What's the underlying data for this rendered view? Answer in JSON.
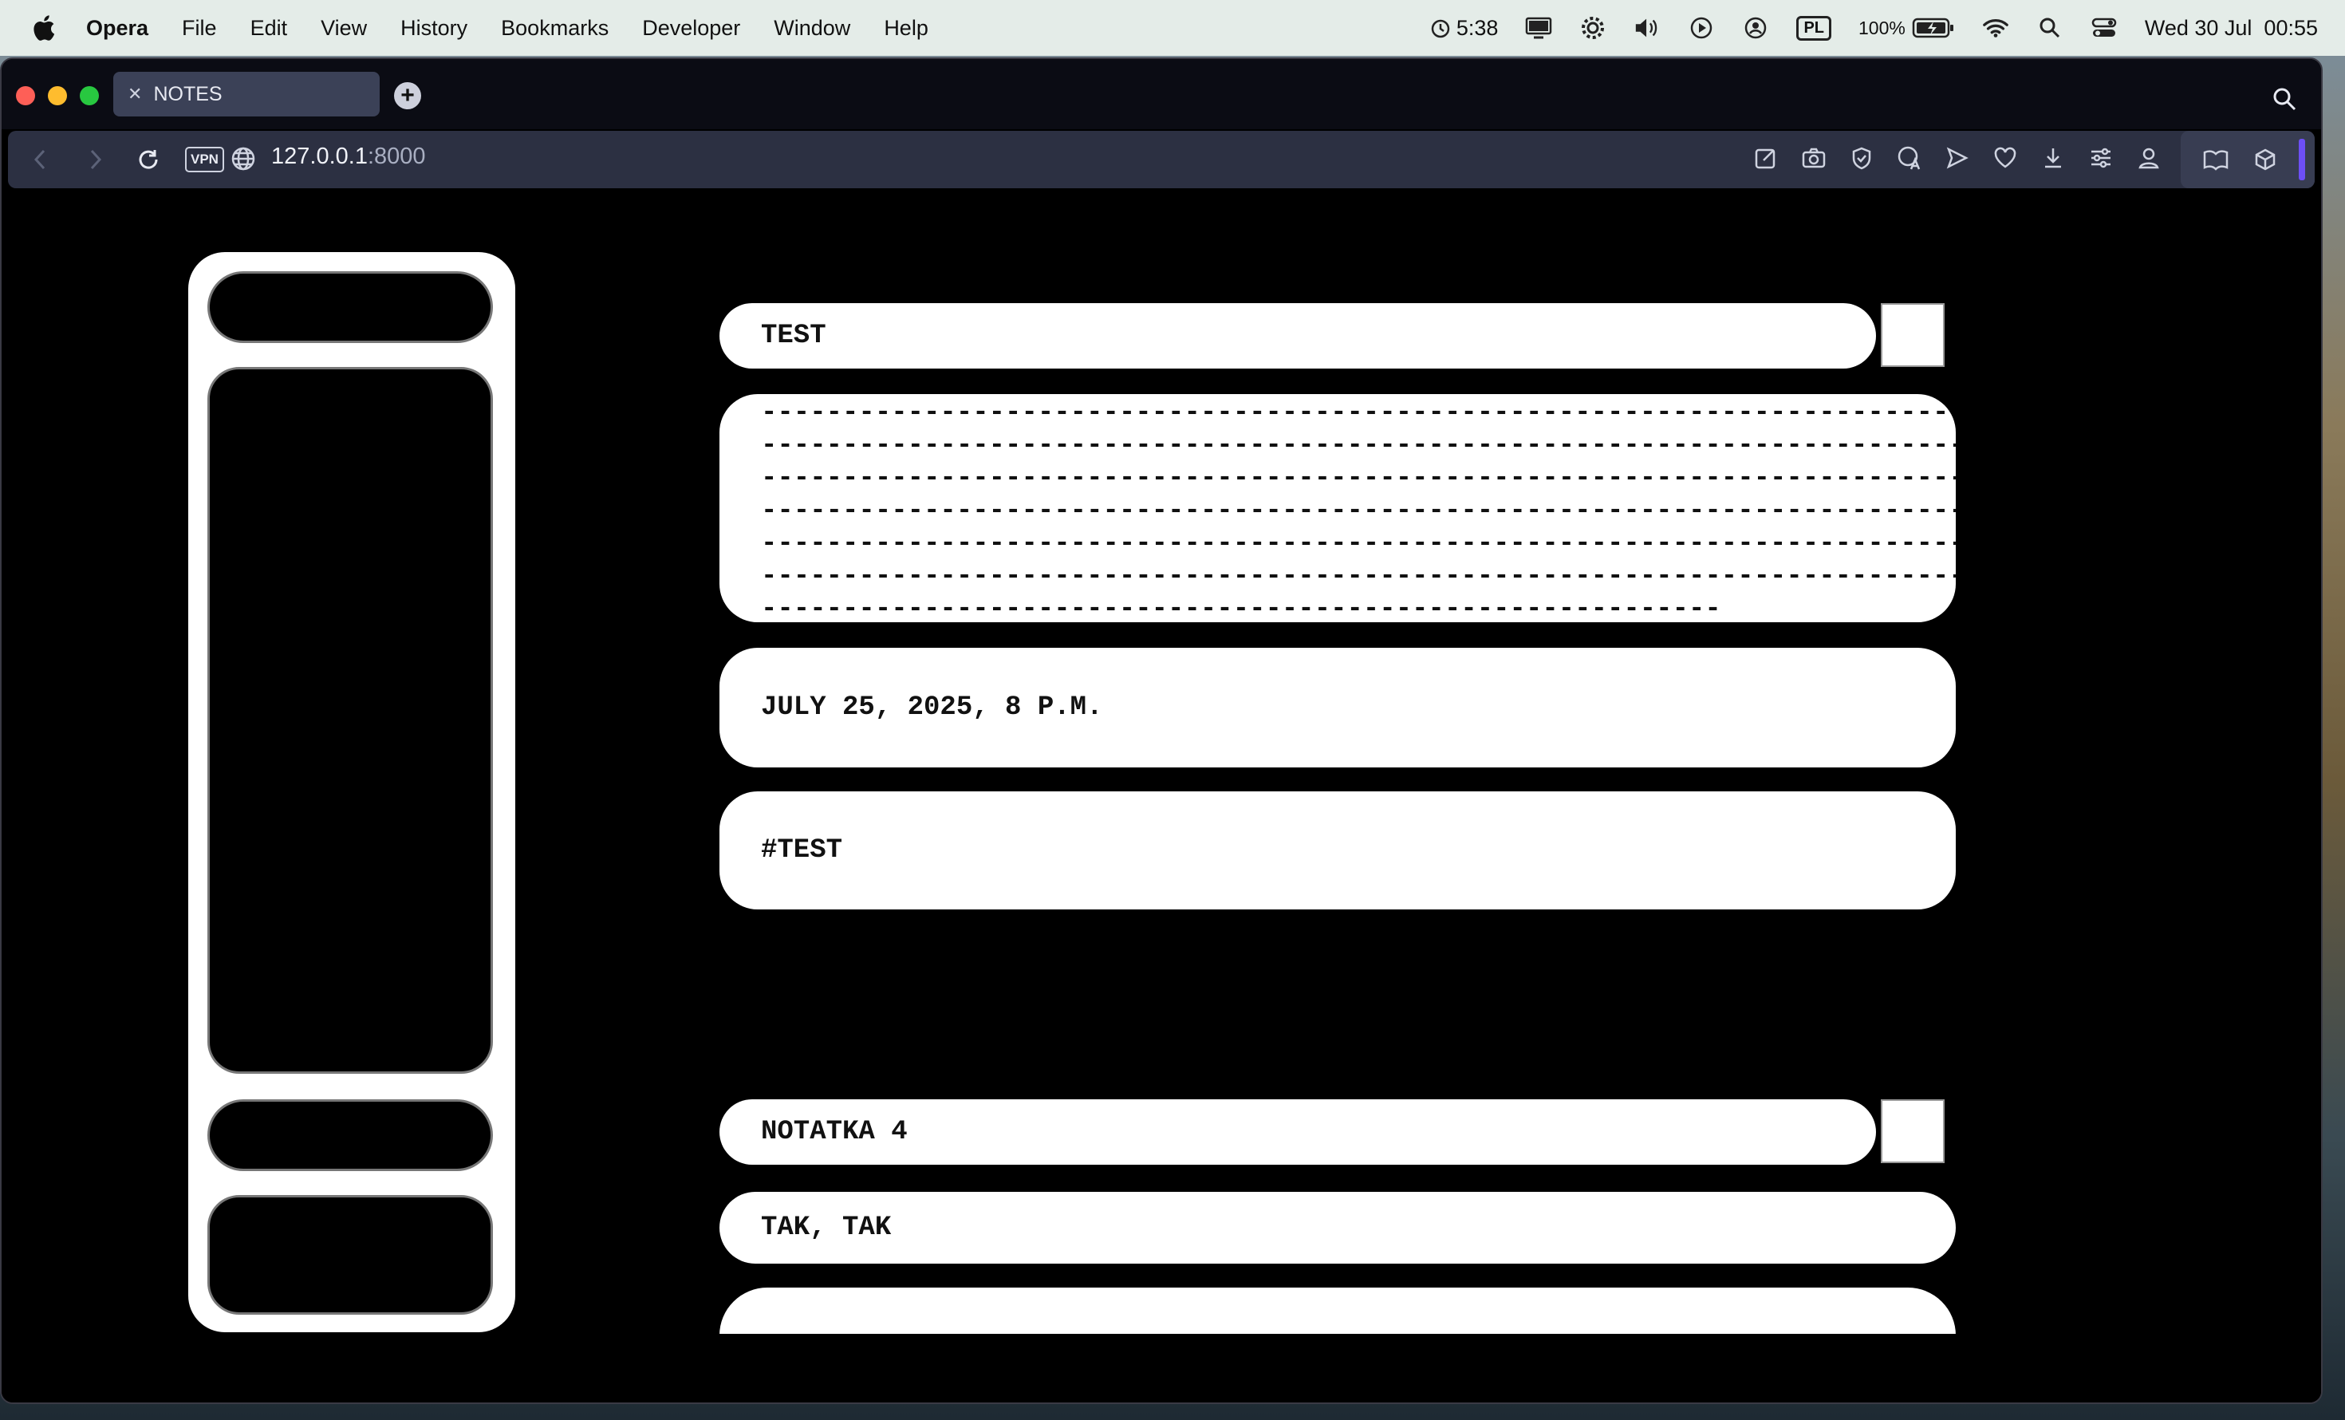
{
  "menubar": {
    "app_name": "Opera",
    "items": [
      "File",
      "Edit",
      "View",
      "History",
      "Bookmarks",
      "Developer",
      "Window",
      "Help"
    ],
    "timer": "5:38",
    "input_source": "PL",
    "battery": "100%",
    "datetime": "Wed 30 Jul  00:55"
  },
  "browser": {
    "tab_title": "NOTES",
    "url_host": "127.0.0.1",
    "url_port": ":8000",
    "vpn_label": "VPN"
  },
  "notes": [
    {
      "title": "TEST",
      "body_lines": [
        "--------------------------------------------------------------------------------------",
        "--------------------------------------------------------------------------------------",
        "--------------------------------------------------------------------------------------",
        "--------------------------------------------------------------------------------------",
        "--------------------------------------------------------------------------------------",
        "--------------------------------------------------------------------------------------",
        "-----------------------------------------------------------"
      ],
      "date": "JULY 25, 2025, 8 P.M.",
      "tags": "#TEST"
    },
    {
      "title": "NOTATKA 4",
      "body": "TAK, TAK"
    }
  ],
  "colors": {
    "page_bg": "#000000",
    "card_bg": "#ffffff",
    "accent": "#6d4ff5"
  }
}
